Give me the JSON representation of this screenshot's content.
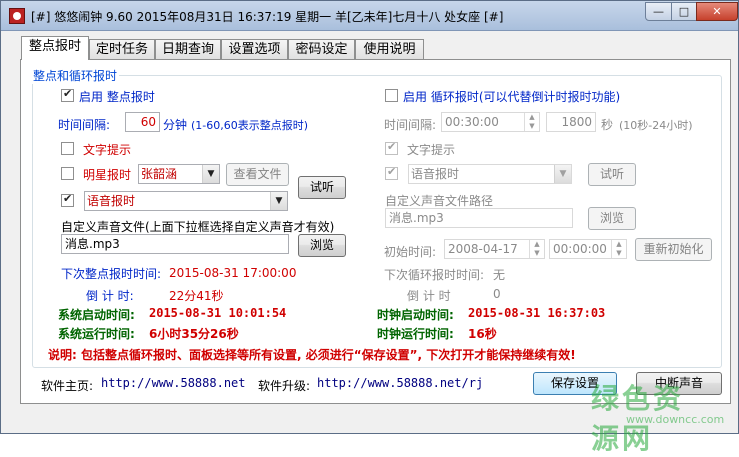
{
  "window": {
    "title": "[#] 悠悠闹钟 9.60 2015年08月31日 16:37:19 星期一 羊[乙未年]七月十八 处女座 [#]",
    "min_glyph": "—",
    "max_glyph": "□",
    "close_glyph": "✕"
  },
  "tabs": [
    {
      "label": "整点报时",
      "active": true
    },
    {
      "label": "定时任务"
    },
    {
      "label": "日期查询"
    },
    {
      "label": "设置选项"
    },
    {
      "label": "密码设定"
    },
    {
      "label": "使用说明"
    }
  ],
  "group": {
    "title": "整点和循环报时"
  },
  "left": {
    "enable_hourly": {
      "label": "启用 整点报时",
      "checked": true
    },
    "interval": {
      "label": "时间间隔:",
      "value": "60",
      "unit": "分钟",
      "hint": "(1-60,60表示整点报时)"
    },
    "text_prompt": {
      "label": "文字提示",
      "checked": false
    },
    "celebrity": {
      "label": "明星报时",
      "checked": false,
      "selected": "张韶涵",
      "view_file_button": "查看文件"
    },
    "voice": {
      "checked": true,
      "selected": "语音报时"
    },
    "test_button": "试听",
    "custom_file_label": "自定义声音文件(上面下拉框选择自定义声音才有效)",
    "custom_file_value": "消息.mp3",
    "browse_button": "浏览",
    "next_label": "下次整点报时时间:",
    "next_value": "2015-08-31 17:00:00",
    "countdown_label": "倒 计 时:",
    "countdown_value": "22分41秒",
    "sys_start_label": "系统启动时间:",
    "sys_start_value": "2015-08-31  10:01:54",
    "sys_run_label": "系统运行时间:",
    "sys_run_value": "6小时35分26秒"
  },
  "right": {
    "enable_cycle": {
      "label": "启用 循环报时(可以代替倒计时报时功能)",
      "checked": false
    },
    "interval_label": "时间间隔:",
    "interval_time": "00:30:00",
    "interval_seconds": "1800",
    "seconds_unit": "秒",
    "seconds_hint": "(10秒-24小时)",
    "text_prompt": {
      "label": "文字提示",
      "checked": true
    },
    "voice": {
      "checked": true,
      "selected": "语音报时"
    },
    "test_button": "试听",
    "custom_path_label": "自定义声音文件路径",
    "custom_path_value": "消息.mp3",
    "browse_button": "浏览",
    "start_label": "初始时间:",
    "start_date": "2008-04-17",
    "start_time": "00:00:00",
    "reinit_button": "重新初始化",
    "next_label": "下次循环报时时间:",
    "next_value": "无",
    "countdown_label": "倒 计 时",
    "countdown_value": "0",
    "clock_start_label": "时钟启动时间:",
    "clock_start_value": "2015-08-31  16:37:03",
    "clock_run_label": "时钟运行时间:",
    "clock_run_value": "16秒"
  },
  "notice": "说明: 包括整点循环报时、面板选择等所有设置, 必须进行“保存设置”, 下次打开才能保持继续有效!",
  "footer": {
    "home_label": "软件主页:",
    "home_url": "http://www.58888.net",
    "upgrade_label": "软件升级:",
    "upgrade_url": "http://www.58888.net/rj",
    "save_button": "保存设置",
    "stop_sound_button": "中断声音"
  },
  "watermark": {
    "logo": "绿色资源网",
    "url": "www.downcc.com"
  }
}
